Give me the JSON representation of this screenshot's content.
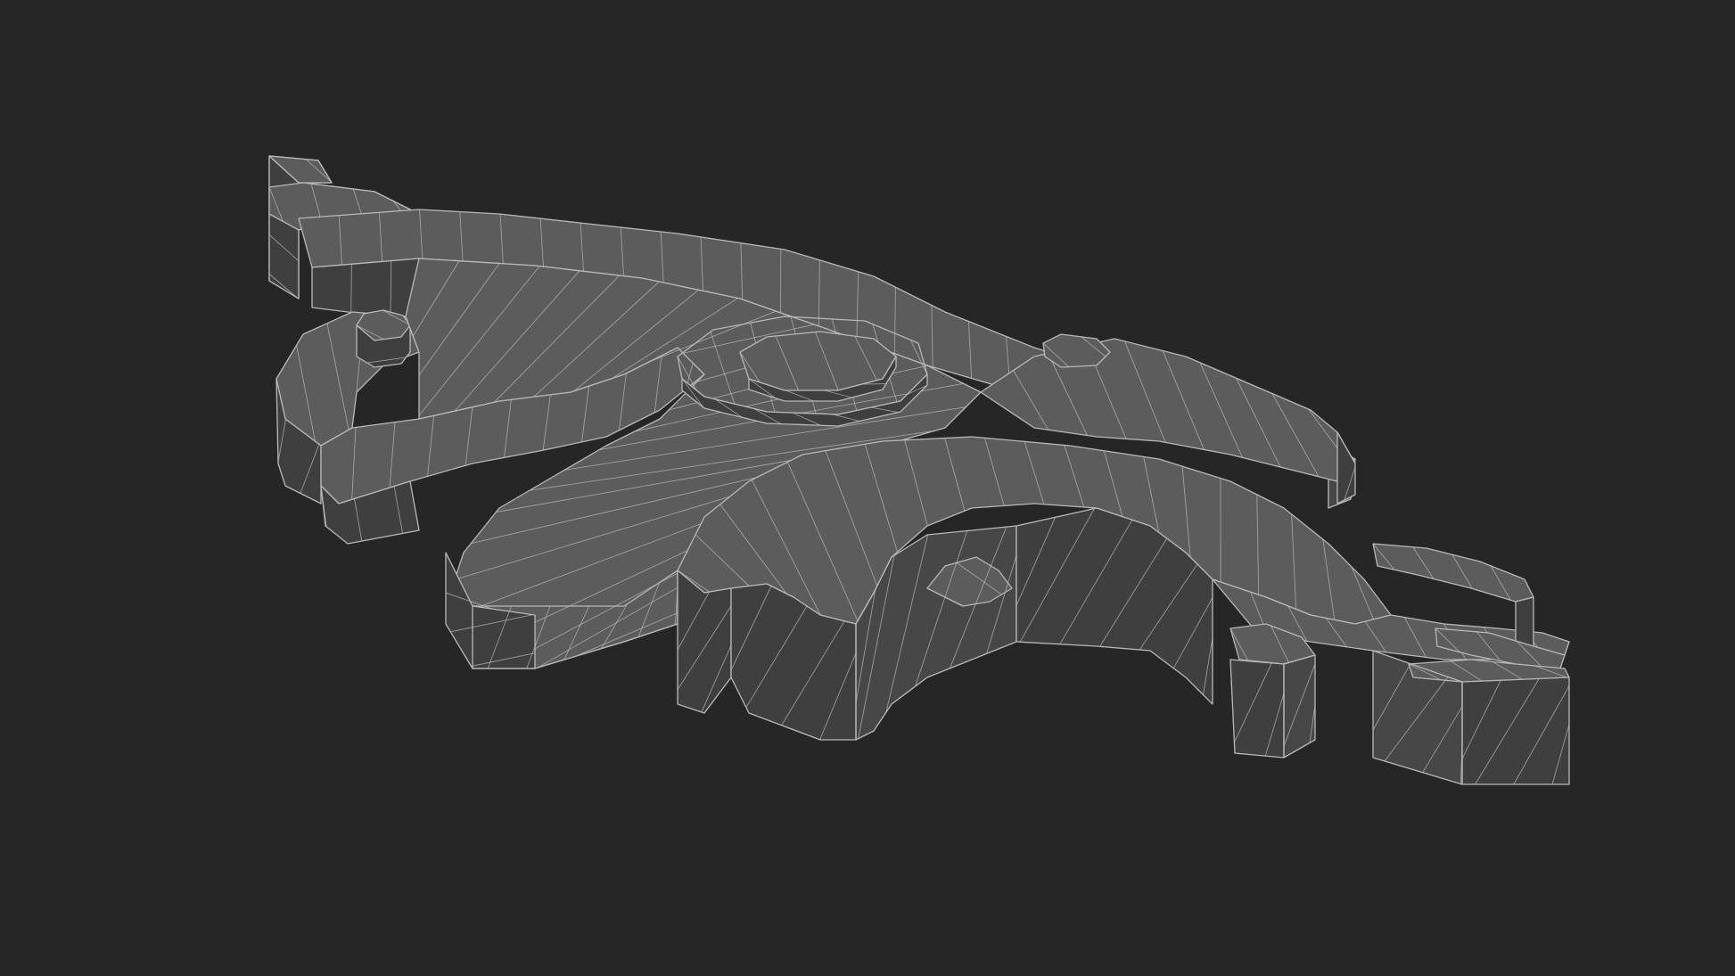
{
  "viewport": {
    "background_color": "#262626",
    "object": {
      "kind": "ornamental-scroll-carving-wireframe",
      "surface_color": "#5c5c5c",
      "side_color": "#3f3f3f",
      "wire_color": "#b8b8b8"
    }
  }
}
